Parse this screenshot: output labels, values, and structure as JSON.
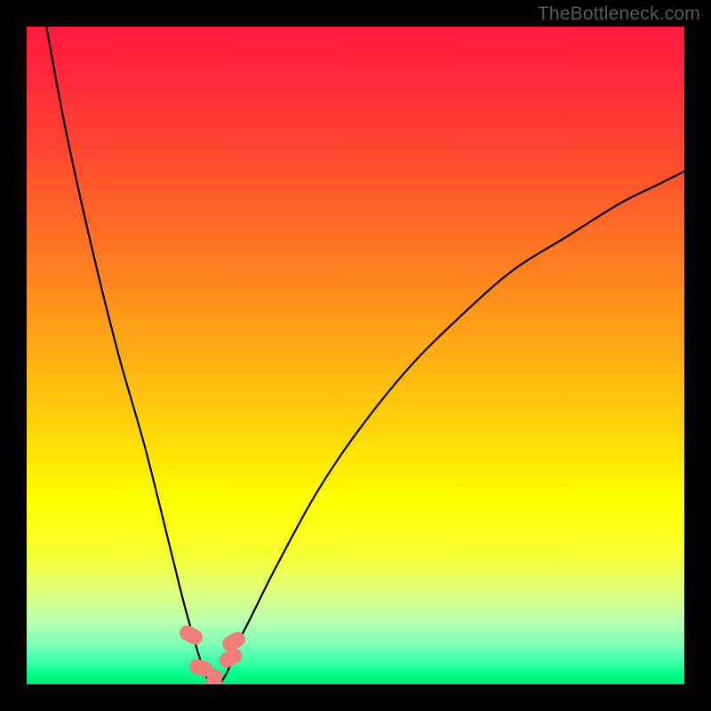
{
  "watermark": "TheBottleneck.com",
  "colors": {
    "frame": "#000000",
    "curve": "#000000",
    "marker_fill": "#ef7e78",
    "marker_stroke": "#ef7e78"
  },
  "gradient_stops": [
    {
      "offset": 0.0,
      "color": "#ff1a3f"
    },
    {
      "offset": 0.08,
      "color": "#ff2a3a"
    },
    {
      "offset": 0.2,
      "color": "#ff4a30"
    },
    {
      "offset": 0.35,
      "color": "#ff7a22"
    },
    {
      "offset": 0.5,
      "color": "#ffae14"
    },
    {
      "offset": 0.62,
      "color": "#ffd80a"
    },
    {
      "offset": 0.72,
      "color": "#ffff00"
    },
    {
      "offset": 0.8,
      "color": "#f7ff30"
    },
    {
      "offset": 0.86,
      "color": "#dfff80"
    },
    {
      "offset": 0.905,
      "color": "#b8ffb0"
    },
    {
      "offset": 0.94,
      "color": "#7dffb8"
    },
    {
      "offset": 0.965,
      "color": "#3effa8"
    },
    {
      "offset": 0.985,
      "color": "#00ff88"
    },
    {
      "offset": 1.0,
      "color": "#00e876"
    }
  ],
  "chart_data": {
    "type": "line",
    "title": "",
    "xlabel": "",
    "ylabel": "",
    "xlim": [
      0,
      100
    ],
    "ylim": [
      0,
      100
    ],
    "notes": "Bottleneck-style V curve. Minimum (0%) around x≈28. Left branch rises to 100% at x≈3; right branch rises and exits top at x≈100 around y≈78. Values estimated from pixels.",
    "series": [
      {
        "name": "bottleneck-curve",
        "x": [
          3,
          6,
          10,
          14,
          18,
          22,
          24,
          26,
          27,
          28,
          29,
          30,
          31,
          32,
          34,
          38,
          44,
          50,
          58,
          66,
          74,
          82,
          90,
          96,
          100
        ],
        "y": [
          100,
          84,
          66,
          50,
          36,
          20,
          12,
          5,
          2,
          0,
          0,
          1,
          3,
          6,
          10,
          18,
          29,
          38,
          48,
          56,
          63,
          68,
          73,
          76,
          78
        ]
      }
    ],
    "markers": [
      {
        "x": 25.0,
        "y": 7.5
      },
      {
        "x": 26.5,
        "y": 2.5
      },
      {
        "x": 28.5,
        "y": 0.5
      },
      {
        "x": 31.0,
        "y": 4.0
      },
      {
        "x": 31.5,
        "y": 6.5
      }
    ]
  }
}
